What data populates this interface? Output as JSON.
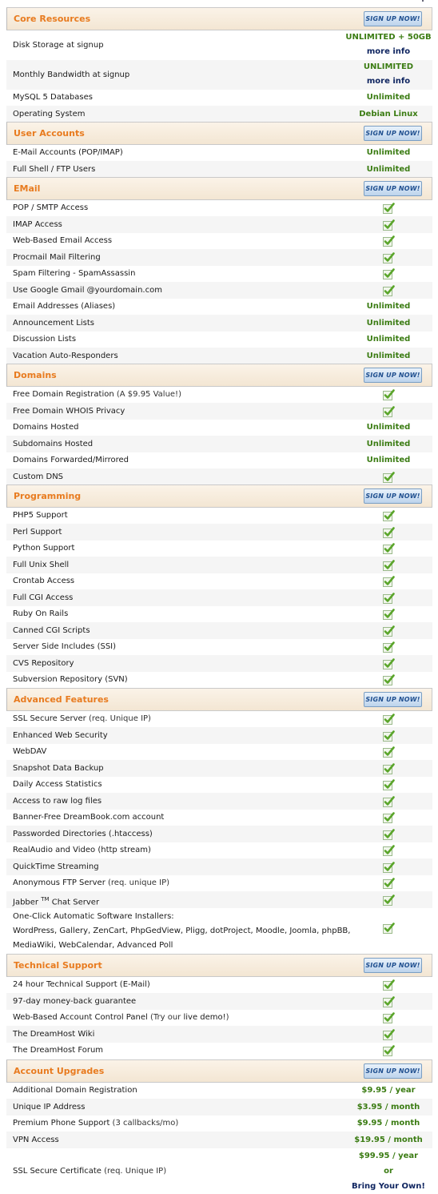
{
  "signup_label": "SIGN UP NOW!",
  "colors": {
    "section_title": "#e87b1f",
    "value_green": "#3b7c13",
    "link_navy": "#0f2560",
    "check_green": "#5aa52a",
    "alt_row": "#f5f5f5"
  },
  "icons": {
    "check": "green-checkmark-icon"
  },
  "sections": [
    {
      "title": "Core Resources",
      "rows": [
        {
          "label": "Disk Storage at signup",
          "value": "UNLIMITED + 50GB",
          "link": "more info"
        },
        {
          "label": "Monthly Bandwidth at signup",
          "value": "UNLIMITED",
          "link": "more info"
        },
        {
          "label": "MySQL 5 Databases",
          "value": "Unlimited"
        },
        {
          "label": "Operating System",
          "value": "Debian Linux"
        }
      ]
    },
    {
      "title": "User Accounts",
      "rows": [
        {
          "label": "E-Mail Accounts (POP/IMAP)",
          "value": "Unlimited"
        },
        {
          "label": "Full Shell / FTP Users",
          "value": "Unlimited"
        }
      ]
    },
    {
      "title": "EMail",
      "rows": [
        {
          "label": "POP / SMTP Access",
          "check": true
        },
        {
          "label": "IMAP Access",
          "check": true
        },
        {
          "label": "Web-Based Email Access",
          "check": true
        },
        {
          "label": "Procmail Mail Filtering",
          "check": true
        },
        {
          "label": "Spam Filtering - SpamAssassin",
          "check": true
        },
        {
          "label": "Use Google Gmail @yourdomain.com",
          "check": true
        },
        {
          "label": "Email Addresses (Aliases)",
          "value": "Unlimited"
        },
        {
          "label": "Announcement Lists",
          "value": "Unlimited"
        },
        {
          "label": "Discussion Lists",
          "value": "Unlimited"
        },
        {
          "label": "Vacation Auto-Responders",
          "value": "Unlimited"
        }
      ]
    },
    {
      "title": "Domains",
      "rows": [
        {
          "label": "Free Domain Registration",
          "note": " (A $9.95 Value!)",
          "check": true
        },
        {
          "label": "Free Domain WHOIS Privacy",
          "check": true
        },
        {
          "label": "Domains Hosted",
          "value": "Unlimited"
        },
        {
          "label": "Subdomains Hosted",
          "value": "Unlimited"
        },
        {
          "label": "Domains Forwarded/Mirrored",
          "value": "Unlimited"
        },
        {
          "label": "Custom DNS",
          "check": true
        }
      ]
    },
    {
      "title": "Programming",
      "rows": [
        {
          "label": "PHP5 Support",
          "check": true
        },
        {
          "label": "Perl Support",
          "check": true
        },
        {
          "label": "Python Support",
          "check": true
        },
        {
          "label": "Full Unix Shell",
          "check": true
        },
        {
          "label": "Crontab Access",
          "check": true
        },
        {
          "label": "Full CGI Access",
          "check": true
        },
        {
          "label": "Ruby On Rails",
          "check": true
        },
        {
          "label": "Canned CGI Scripts",
          "check": true
        },
        {
          "label": "Server Side Includes (SSI)",
          "check": true
        },
        {
          "label": "CVS Repository",
          "check": true
        },
        {
          "label": "Subversion Repository (SVN)",
          "check": true
        }
      ]
    },
    {
      "title": "Advanced Features",
      "rows": [
        {
          "label": "SSL Secure Server",
          "note": " (req. Unique IP)",
          "check": true
        },
        {
          "label": "Enhanced Web Security",
          "check": true
        },
        {
          "label": "WebDAV",
          "check": true
        },
        {
          "label": "Snapshot Data Backup",
          "check": true
        },
        {
          "label": "Daily Access Statistics",
          "check": true
        },
        {
          "label": "Access to raw log files",
          "check": true
        },
        {
          "label": "Banner-Free DreamBook.com account",
          "check": true
        },
        {
          "label": "Passworded Directories (.htaccess)",
          "check": true
        },
        {
          "label": "RealAudio and Video (http stream)",
          "check": true
        },
        {
          "label": "QuickTime Streaming",
          "check": true
        },
        {
          "label": "Anonymous FTP Server",
          "note": " (req. unique IP)",
          "check": true
        },
        {
          "label": "Jabber ",
          "sup": "TM",
          "label2": " Chat Server",
          "check": true
        },
        {
          "label": "One-Click Automatic Software Installers:",
          "lines": [
            "WordPress, Gallery, ZenCart, PhpGedView, Pligg, dotProject, Moodle, Joomla, phpBB,",
            "MediaWiki, WebCalendar, Advanced Poll"
          ],
          "check": true
        }
      ]
    },
    {
      "title": "Technical Support",
      "rows": [
        {
          "label": "24 hour Technical Support (E-Mail)",
          "check": true
        },
        {
          "label": "97-day money-back guarantee",
          "check": true
        },
        {
          "label": "Web-Based Account Control Panel",
          "note": " (Try our ",
          "note_link": "live demo!",
          "note_end": ")",
          "check": true
        },
        {
          "label": "The DreamHost Wiki",
          "check": true
        },
        {
          "label": "The DreamHost Forum",
          "check": true
        }
      ]
    },
    {
      "title": "Account Upgrades",
      "rows": [
        {
          "label": "Additional Domain Registration",
          "value": "$9.95",
          "unit": " / year"
        },
        {
          "label": "Unique IP Address",
          "value": "$3.95",
          "unit": " / month"
        },
        {
          "label": "Premium Phone Support",
          "note": " (3 callbacks/mo)",
          "value": "$9.95",
          "unit": " / month"
        },
        {
          "label": "VPN Access",
          "value": "$19.95",
          "unit": " / month"
        },
        {
          "label": "SSL Secure Certificate",
          "note": " (req. Unique IP)",
          "value": "$99.95",
          "unit": " / year",
          "or": "or",
          "link": "Bring Your Own!"
        }
      ]
    }
  ]
}
